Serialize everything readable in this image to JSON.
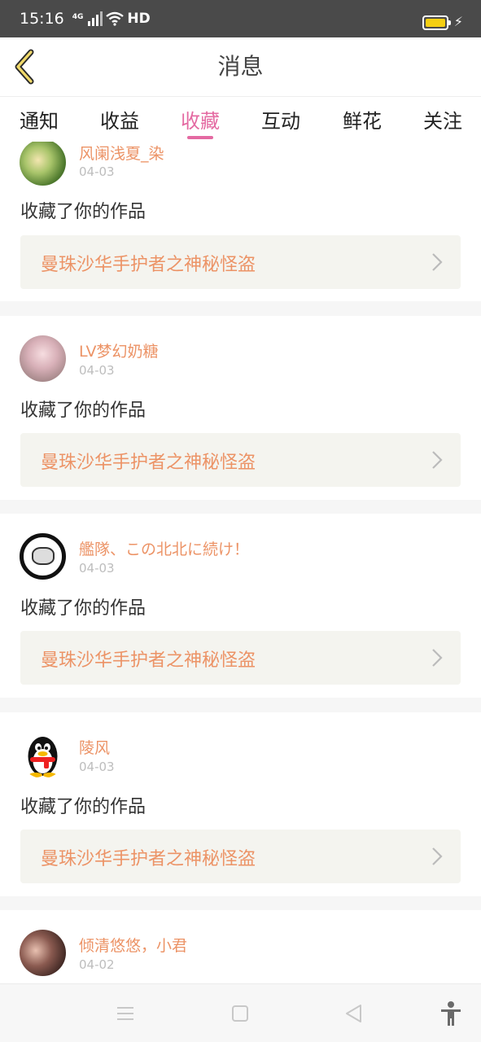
{
  "status_bar": {
    "time": "15:16",
    "network": "4G",
    "hd": "HD",
    "battery_color": "#f5cf12"
  },
  "header": {
    "back_icon": "chevron-left-icon",
    "title": "消息"
  },
  "tabs": [
    {
      "label": "通知",
      "active": false
    },
    {
      "label": "收益",
      "active": false
    },
    {
      "label": "收藏",
      "active": true
    },
    {
      "label": "互动",
      "active": false
    },
    {
      "label": "鲜花",
      "active": false
    },
    {
      "label": "关注",
      "active": false
    }
  ],
  "accent_color": "#e46aa2",
  "name_color": "#ec9366",
  "items": [
    {
      "user": "风阑浅夏_染",
      "date": "04-03",
      "action": "收藏了你的作品",
      "work": "曼珠沙华手护者之神秘怪盗"
    },
    {
      "user": "LV梦幻奶糖",
      "date": "04-03",
      "action": "收藏了你的作品",
      "work": "曼珠沙华手护者之神秘怪盗"
    },
    {
      "user": "艦隊、この北北に続け！",
      "date": "04-03",
      "action": "收藏了你的作品",
      "work": "曼珠沙华手护者之神秘怪盗"
    },
    {
      "user": "陵风",
      "date": "04-03",
      "action": "收藏了你的作品",
      "work": "曼珠沙华手护者之神秘怪盗"
    },
    {
      "user": "倾清悠悠，小君",
      "date": "04-02",
      "action": "",
      "work": ""
    }
  ],
  "nav_bar": {
    "icons": [
      "menu-icon",
      "home-square-icon",
      "back-triangle-icon",
      "accessibility-icon"
    ]
  }
}
